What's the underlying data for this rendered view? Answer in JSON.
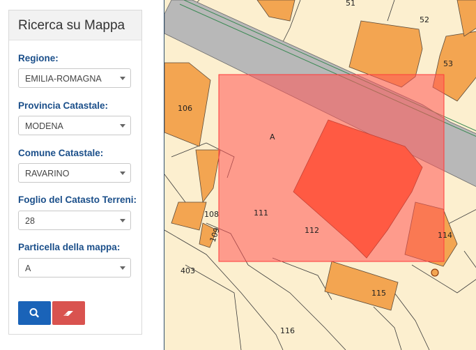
{
  "sidebar": {
    "title": "Ricerca su Mappa",
    "fields": [
      {
        "label": "Regione:",
        "value": "EMILIA-ROMAGNA"
      },
      {
        "label": "Provincia Catastale:",
        "value": "MODENA"
      },
      {
        "label": "Comune Catastale:",
        "value": "RAVARINO"
      },
      {
        "label": "Foglio del Catasto Terreni:",
        "value": "28"
      },
      {
        "label": "Particella della mappa:",
        "value": "A"
      }
    ],
    "buttons": {
      "search_icon": "search-icon",
      "clear_icon": "eraser-icon"
    }
  },
  "map": {
    "parcel_labels": [
      "51",
      "52",
      "53",
      "106",
      "A",
      "108",
      "109",
      "111",
      "112",
      "114",
      "403",
      "115",
      "116"
    ],
    "colors": {
      "background": "#fcefcf",
      "building": "#f3a551",
      "road": "#b8b8b8",
      "highlight": "#ff6060",
      "selected_building": "#ff5f2e",
      "search_button": "#1a63b8",
      "clear_button": "#d9534f"
    }
  }
}
